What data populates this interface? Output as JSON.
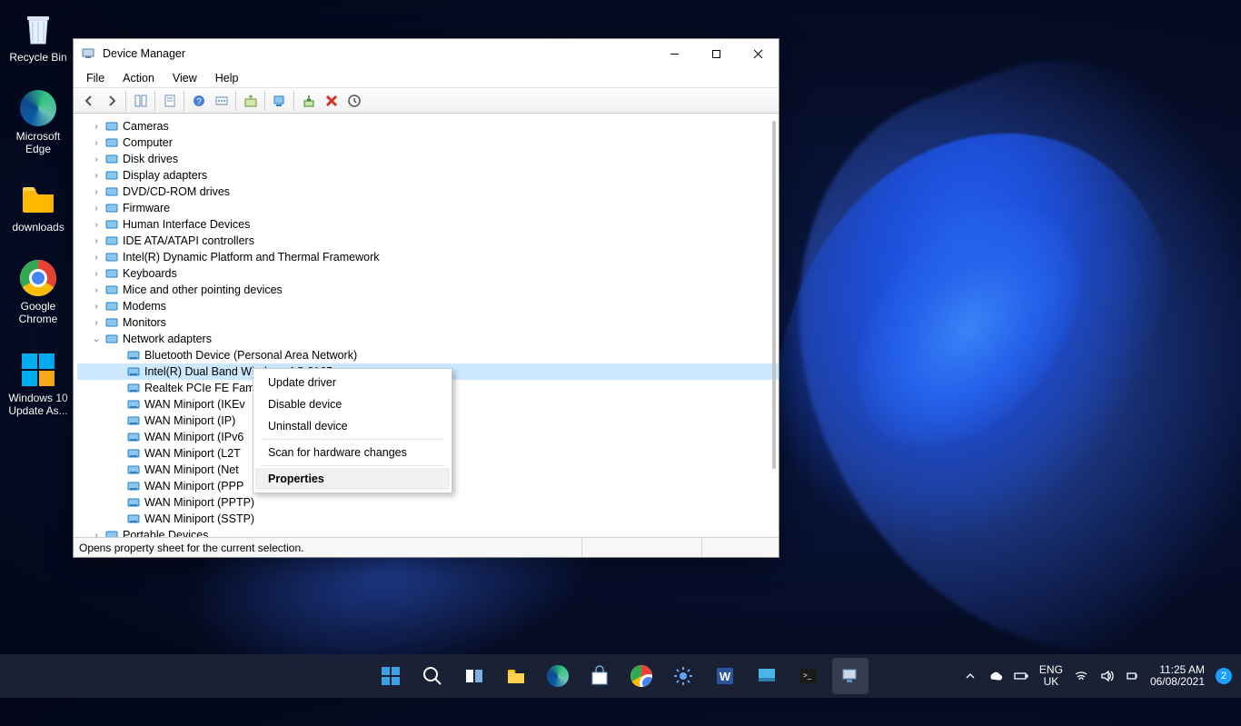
{
  "desktop": {
    "icons": [
      {
        "label": "Recycle Bin"
      },
      {
        "label": "Microsoft Edge"
      },
      {
        "label": "downloads"
      },
      {
        "label": "Google Chrome"
      },
      {
        "label": "Windows 10 Update As..."
      }
    ]
  },
  "window": {
    "title": "Device Manager",
    "menu": [
      "File",
      "Action",
      "View",
      "Help"
    ],
    "statusbar": "Opens property sheet for the current selection."
  },
  "tree": {
    "nodes": [
      {
        "label": "Cameras",
        "expanded": false
      },
      {
        "label": "Computer",
        "expanded": false
      },
      {
        "label": "Disk drives",
        "expanded": false
      },
      {
        "label": "Display adapters",
        "expanded": false
      },
      {
        "label": "DVD/CD-ROM drives",
        "expanded": false
      },
      {
        "label": "Firmware",
        "expanded": false
      },
      {
        "label": "Human Interface Devices",
        "expanded": false
      },
      {
        "label": "IDE ATA/ATAPI controllers",
        "expanded": false
      },
      {
        "label": "Intel(R) Dynamic Platform and Thermal Framework",
        "expanded": false
      },
      {
        "label": "Keyboards",
        "expanded": false
      },
      {
        "label": "Mice and other pointing devices",
        "expanded": false
      },
      {
        "label": "Modems",
        "expanded": false
      },
      {
        "label": "Monitors",
        "expanded": false
      },
      {
        "label": "Network adapters",
        "expanded": true,
        "children": [
          {
            "label": "Bluetooth Device (Personal Area Network)"
          },
          {
            "label": "Intel(R) Dual Band Wireless-AC 3165",
            "selected": true
          },
          {
            "label": "Realtek PCIe FE Fam"
          },
          {
            "label": "WAN Miniport (IKEv"
          },
          {
            "label": "WAN Miniport (IP)"
          },
          {
            "label": "WAN Miniport (IPv6"
          },
          {
            "label": "WAN Miniport (L2T"
          },
          {
            "label": "WAN Miniport (Net"
          },
          {
            "label": "WAN Miniport (PPP"
          },
          {
            "label": "WAN Miniport (PPTP)"
          },
          {
            "label": "WAN Miniport (SSTP)"
          }
        ]
      },
      {
        "label": "Portable Devices",
        "expanded": false
      }
    ]
  },
  "context_menu": {
    "items": [
      {
        "label": "Update driver"
      },
      {
        "label": "Disable device"
      },
      {
        "label": "Uninstall device"
      },
      {
        "sep": true
      },
      {
        "label": "Scan for hardware changes"
      },
      {
        "sep": true
      },
      {
        "label": "Properties",
        "hover": true
      }
    ]
  },
  "tray": {
    "lang1": "ENG",
    "lang2": "UK",
    "time": "11:25 AM",
    "date": "06/08/2021",
    "badge": "2"
  }
}
